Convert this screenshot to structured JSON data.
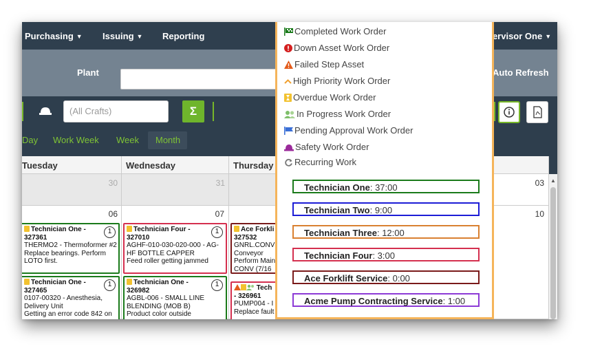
{
  "nav": {
    "purchasing": "Purchasing",
    "issuing": "Issuing",
    "reporting": "Reporting",
    "user": "pervisor One"
  },
  "plantbar": {
    "plant_label": "Plant",
    "auto_refresh": "Auto Refresh"
  },
  "toolbar": {
    "crafts_placeholder": "(All Crafts)",
    "sigma": "Σ"
  },
  "views": {
    "day": "Day",
    "work_week": "Work Week",
    "week": "Week",
    "month": "Month",
    "active": "Month"
  },
  "calendar": {
    "days": [
      "Tuesday",
      "Wednesday",
      "Thursday"
    ],
    "prev_row": [
      "30",
      "31",
      "",
      "03"
    ],
    "row": [
      "06",
      "07",
      "",
      "10"
    ],
    "cards": [
      {
        "title": "Technician One -",
        "id": "327361",
        "line1": "THERMO2 - Thermoformer #2",
        "line2": "Replace bearings. Perform",
        "line3": "LOTO first.",
        "count": "1",
        "border": "#1a7a1a"
      },
      {
        "title": "Technician Four -",
        "id": "327010",
        "line1": "AGHF-010-030-020-000 - AG-",
        "line2": "HF BOTTLE CAPPER",
        "line3": "Feed roller getting jammed",
        "count": "1",
        "border": "#d42f4e"
      },
      {
        "title": "Ace Forkli",
        "id": "327532",
        "line1": "GNRL.CONV",
        "line2": "Conveyor",
        "line3": "Perform Main",
        "line4": "CONV (7/16",
        "border": "#7a1a1a"
      },
      {
        "title": "Technician One -",
        "id": "327465",
        "line1": "0107-00320 - Anesthesia,",
        "line2": "Delivery Unit",
        "line3": "Getting an error code 842 on",
        "count": "1",
        "border": "#1a7a1a"
      },
      {
        "title": "Technician One -",
        "id": "326982",
        "line1": "AGBL-006 - SMALL LINE",
        "line2": "BLENDING (MOB B)",
        "line3": "Product color outside",
        "count": "1",
        "border": "#1a7a1a"
      },
      {
        "title": "Tech",
        "id": "- 326961",
        "line1": "PUMP004 - I",
        "line2": "Replace fault",
        "border": "#d42f4e"
      }
    ]
  },
  "legend": {
    "items": [
      {
        "label": "Completed Work Order",
        "icon": "checkered-flag-icon"
      },
      {
        "label": "Down Asset Work Order",
        "icon": "alert-circle-icon"
      },
      {
        "label": "Failed Step Asset",
        "icon": "warning-triangle-icon"
      },
      {
        "label": "High Priority Work Order",
        "icon": "chevron-up-icon"
      },
      {
        "label": "Overdue Work Order",
        "icon": "hourglass-icon"
      },
      {
        "label": "In Progress Work Order",
        "icon": "users-icon"
      },
      {
        "label": "Pending Approval Work Order",
        "icon": "flag-icon"
      },
      {
        "label": "Safety Work Order",
        "icon": "hard-hat-icon"
      },
      {
        "label": "Recurring Work",
        "icon": "recurring-icon"
      }
    ],
    "technicians": [
      {
        "name": "Technician One",
        "hours": ": 37:00",
        "color": "#1a7a1a"
      },
      {
        "name": "Technician Two",
        "hours": ": 9:00",
        "color": "#1c1cd6"
      },
      {
        "name": "Technician Three",
        "hours": ": 12:00",
        "color": "#d98030"
      },
      {
        "name": "Technician Four",
        "hours": ": 3:00",
        "color": "#d42f4e"
      },
      {
        "name": "Ace Forklift Service",
        "hours": ": 0:00",
        "color": "#7a1a1a"
      },
      {
        "name": "Acme Pump Contracting Service",
        "hours": ": 1:00",
        "color": "#8c3ad6"
      }
    ]
  }
}
